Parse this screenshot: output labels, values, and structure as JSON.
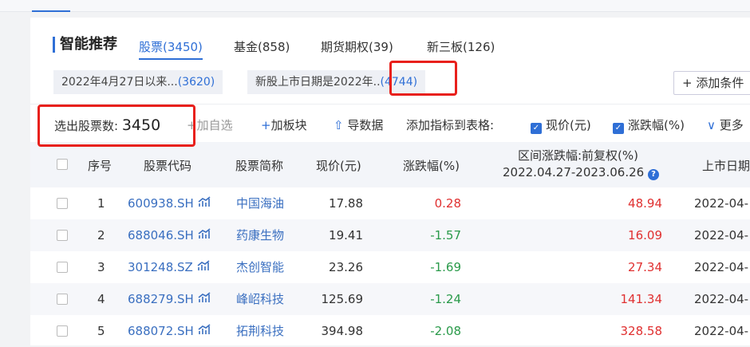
{
  "title": "智能推荐",
  "tabs": [
    {
      "label": "股票(3450)"
    },
    {
      "label": "基金(858)"
    },
    {
      "label": "期货期权(39)"
    },
    {
      "label": "新三板(126)"
    }
  ],
  "conditions": [
    {
      "text": "2022年4月27日以来...",
      "count": "(3620)"
    },
    {
      "text": "新股上市日期是2022年..",
      "count": "(4744)"
    }
  ],
  "add_condition": "添加条件",
  "toolbar": {
    "count_label": "选出股票数:",
    "count": "3450",
    "add_watch": "加自选",
    "add_block": "加板块",
    "export": "导数据",
    "add_metric": "添加指标到表格:",
    "metric1": "现价(元)",
    "metric2": "涨跌幅(%)",
    "more": "更多"
  },
  "headers": {
    "index": "序号",
    "code": "股票代码",
    "name": "股票简称",
    "price": "现价(元)",
    "change": "涨跌幅(%)",
    "range": "区间涨跌幅:前复权(%)",
    "range_dates": "2022.04.27-2023.06.26",
    "listing": "上市日期"
  },
  "rows": [
    {
      "index": "1",
      "code": "600938.SH",
      "name": "中国海油",
      "price": "17.88",
      "change": "0.28",
      "range": "48.94",
      "date": "2022-04-"
    },
    {
      "index": "2",
      "code": "688046.SH",
      "name": "药康生物",
      "price": "19.41",
      "change": "-1.57",
      "range": "16.09",
      "date": "2022-04-"
    },
    {
      "index": "3",
      "code": "301248.SZ",
      "name": "杰创智能",
      "price": "23.26",
      "change": "-1.69",
      "range": "27.34",
      "date": "2022-04-"
    },
    {
      "index": "4",
      "code": "688279.SH",
      "name": "峰岹科技",
      "price": "125.69",
      "change": "-1.24",
      "range": "141.34",
      "date": "2022-04-"
    },
    {
      "index": "5",
      "code": "688072.SH",
      "name": "拓荆科技",
      "price": "394.98",
      "change": "-2.08",
      "range": "328.58",
      "date": "2022-04-"
    }
  ]
}
